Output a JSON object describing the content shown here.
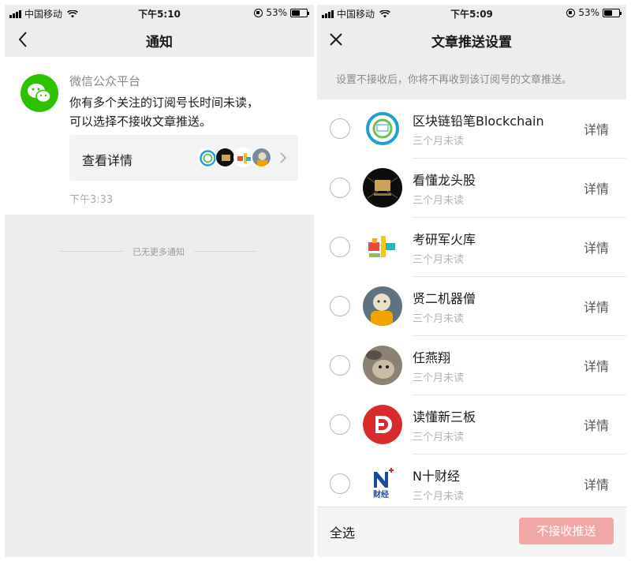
{
  "left_screen": {
    "status_bar": {
      "carrier": "中国移动",
      "time": "下午5:10",
      "battery": "53%",
      "battery_level": 0.53
    },
    "nav": {
      "title": "通知",
      "back_icon": "chevron-left-icon"
    },
    "notification": {
      "sender": "微信公众平台",
      "message_line1": "你有多个关注的订阅号长时间未读，",
      "message_line2": "可以选择不接收文章推送。",
      "detail_label": "查看详情",
      "time": "下午3:33"
    },
    "end_text": "已无更多通知"
  },
  "right_screen": {
    "status_bar": {
      "carrier": "中国移动",
      "time": "下午5:09",
      "battery": "53%",
      "battery_level": 0.53
    },
    "nav": {
      "title": "文章推送设置",
      "close_icon": "close-icon"
    },
    "hint": "设置不接收后，你将不再收到该订阅号的文章推送。",
    "accounts": [
      {
        "name": "区块链铅笔Blockchain",
        "status": "三个月未读",
        "detail": "详情"
      },
      {
        "name": "看懂龙头股",
        "status": "三个月未读",
        "detail": "详情"
      },
      {
        "name": "考研军火库",
        "status": "三个月未读",
        "detail": "详情"
      },
      {
        "name": "贤二机器僧",
        "status": "三个月未读",
        "detail": "详情"
      },
      {
        "name": "任燕翔",
        "status": "三个月未读",
        "detail": "详情"
      },
      {
        "name": "读懂新三板",
        "status": "三个月未读",
        "detail": "详情"
      },
      {
        "name": "N十财经",
        "status": "三个月未读",
        "detail": "详情"
      }
    ],
    "select_all": "全选",
    "unsubscribe_button": "不接收推送"
  },
  "colors": {
    "wechat_green": "#2dc100",
    "unsubscribe_disabled": "#f2a7a7",
    "background_gray": "#ededed"
  }
}
